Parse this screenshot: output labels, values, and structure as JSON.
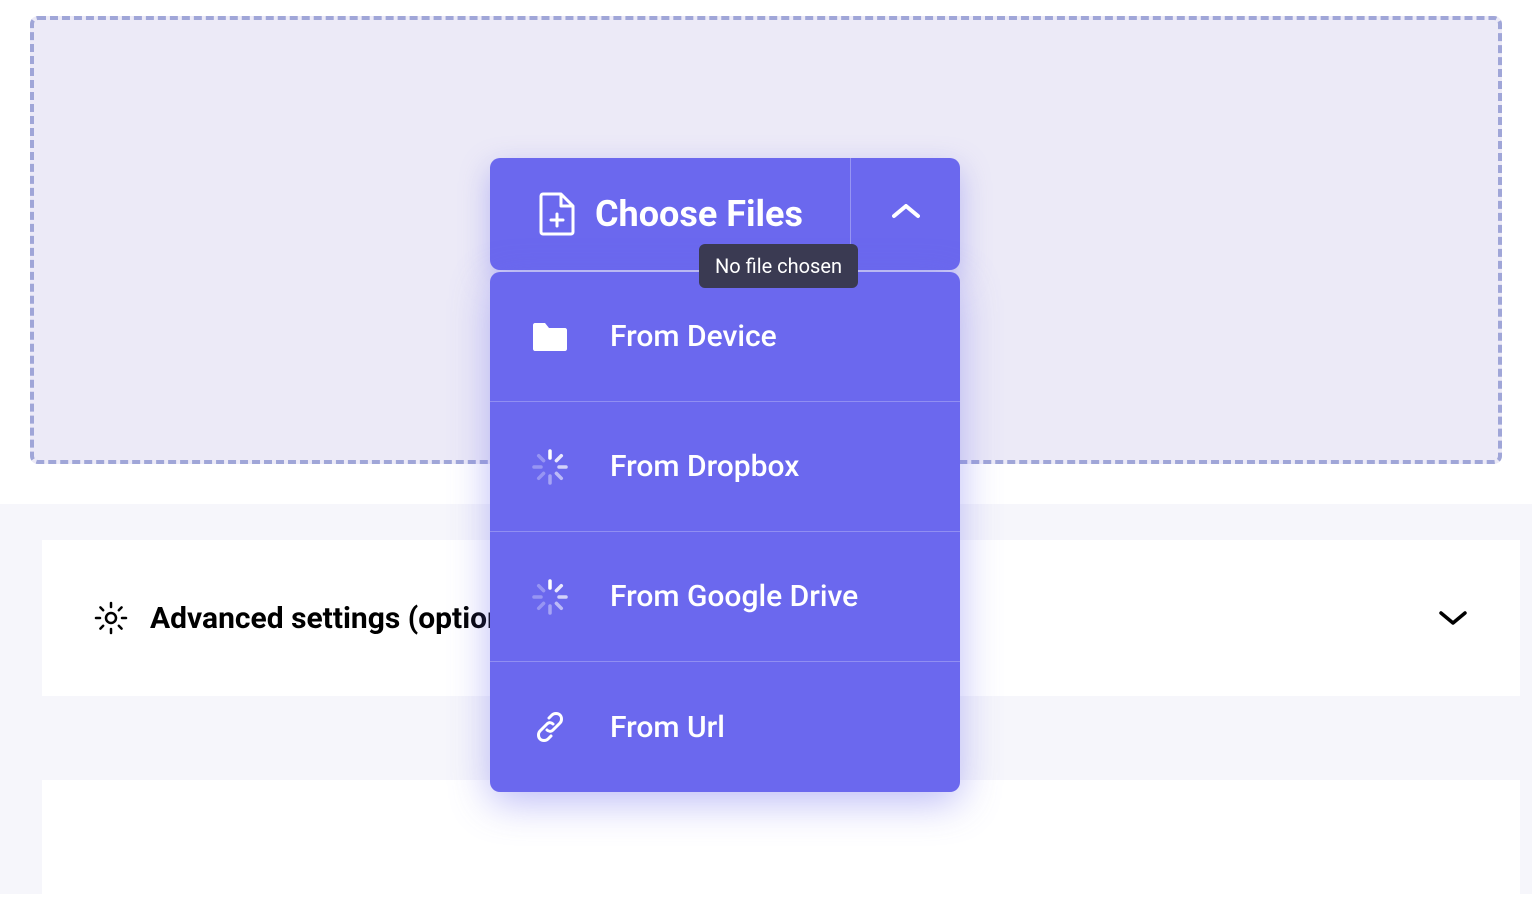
{
  "uploader": {
    "button_label": "Choose Files",
    "tooltip": "No file chosen",
    "sources": [
      {
        "label": "From Device",
        "icon": "folder"
      },
      {
        "label": "From Dropbox",
        "icon": "spinner"
      },
      {
        "label": "From Google Drive",
        "icon": "spinner"
      },
      {
        "label": "From Url",
        "icon": "link"
      }
    ]
  },
  "advanced": {
    "label": "Advanced settings (optional)"
  },
  "colors": {
    "primary": "#6b68ee",
    "dropzone_bg": "#eceaf7",
    "dropzone_border": "#a0a6d8",
    "tooltip_bg": "#3a3a52"
  }
}
